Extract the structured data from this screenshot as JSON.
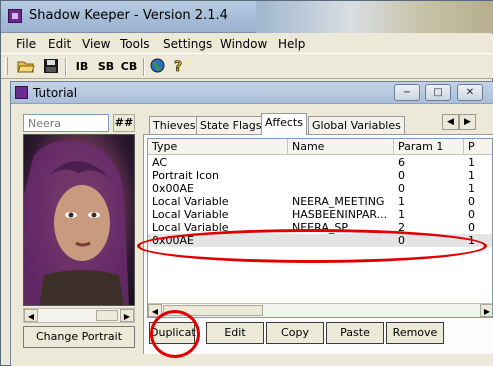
{
  "app": {
    "title": "Shadow Keeper - Version 2.1.4"
  },
  "menu": [
    "File",
    "Edit",
    "View",
    "Tools",
    "Settings",
    "Window",
    "Help"
  ],
  "toolbar": {
    "open_icon": "folder-open-icon",
    "save_icon": "floppy-icon",
    "ib": "IB",
    "sb": "SB",
    "cb": "CB",
    "globe_icon": "globe-icon",
    "help_icon": "help-icon"
  },
  "child": {
    "title": "Tutorial",
    "minimize": "−",
    "restore": "□",
    "close": "✕"
  },
  "character": {
    "name": "Neera",
    "hash_label": "##",
    "change_portrait": "Change Portrait"
  },
  "tabs": [
    "Thieves",
    "State Flags",
    "Affects",
    "Global Variables"
  ],
  "active_tab": "Affects",
  "list": {
    "columns": [
      "Type",
      "Name",
      "Param 1",
      "P"
    ],
    "rows": [
      {
        "type": "AC",
        "name": "",
        "param1": "6",
        "p": "1"
      },
      {
        "type": "Portrait Icon",
        "name": "",
        "param1": "0",
        "p": "1"
      },
      {
        "type": "0x00AE",
        "name": "",
        "param1": "0",
        "p": "1"
      },
      {
        "type": "Local Variable",
        "name": "NEERA_MEETING",
        "param1": "1",
        "p": "0"
      },
      {
        "type": "Local Variable",
        "name": "HASBEENINPAR...",
        "param1": "1",
        "p": "0"
      },
      {
        "type": "Local Variable",
        "name": "NEERA_SP",
        "param1": "2",
        "p": "0"
      },
      {
        "type": "0x00AE",
        "name": "",
        "param1": "0",
        "p": "1"
      }
    ],
    "selected_row": 6
  },
  "buttons": {
    "duplicate": "Duplicat",
    "edit": "Edit",
    "copy": "Copy",
    "paste": "Paste",
    "remove": "Remove"
  },
  "colors": {
    "annotation": "#e00000",
    "titlebar": "#a9bfd9"
  }
}
